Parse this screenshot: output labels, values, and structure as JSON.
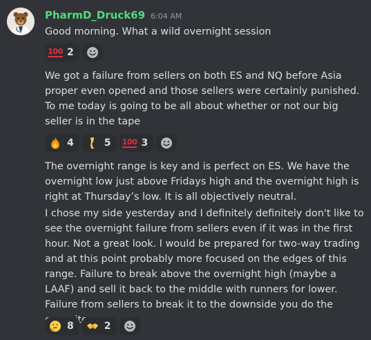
{
  "author": {
    "username": "PharmD_Druck69",
    "timestamp": "6:04 AM"
  },
  "messages": [
    {
      "text": "Good morning. What a wild overnight session",
      "reactions": [
        {
          "emoji": "hundred-points-icon",
          "count": "2"
        }
      ]
    },
    {
      "text": "We got a failure from sellers on both ES and NQ before Asia proper even opened and those sellers were certainly punished. To me today is going to be all about whether or not our big seller is in the tape",
      "reactions": [
        {
          "emoji": "fire-icon",
          "count": "4"
        },
        {
          "emoji": "leg-icon",
          "count": "5"
        },
        {
          "emoji": "hundred-points-icon",
          "count": "3"
        }
      ]
    },
    {
      "text": "The overnight range is key and is perfect on ES. We have the overnight low just above Fridays high and the overnight high is right at Thursday’s low. It is all objectively neutral."
    },
    {
      "text": "I chose my side yesterday and I definitely definitely don't like to see the overnight failure from sellers even if it was in the first hour. Not a great look. I would be prepared for two-way trading and at this point probably more focused on the edges of this range. Failure to break above the overnight high (maybe a LAAF) and sell it back to the middle with runners for lower. Failure from sellers to break it to the downside you do the opposite.",
      "reactions": [
        {
          "emoji": "thinking-face-icon",
          "count": "8"
        },
        {
          "emoji": "handshake-icon",
          "count": "2"
        }
      ]
    }
  ],
  "hundred_glyph": "100",
  "colors": {
    "background": "#313338",
    "username": "#4fdc7c",
    "text": "#dbdee1",
    "timestamp": "#949ba4",
    "reaction_bg": "#2b2d31"
  }
}
